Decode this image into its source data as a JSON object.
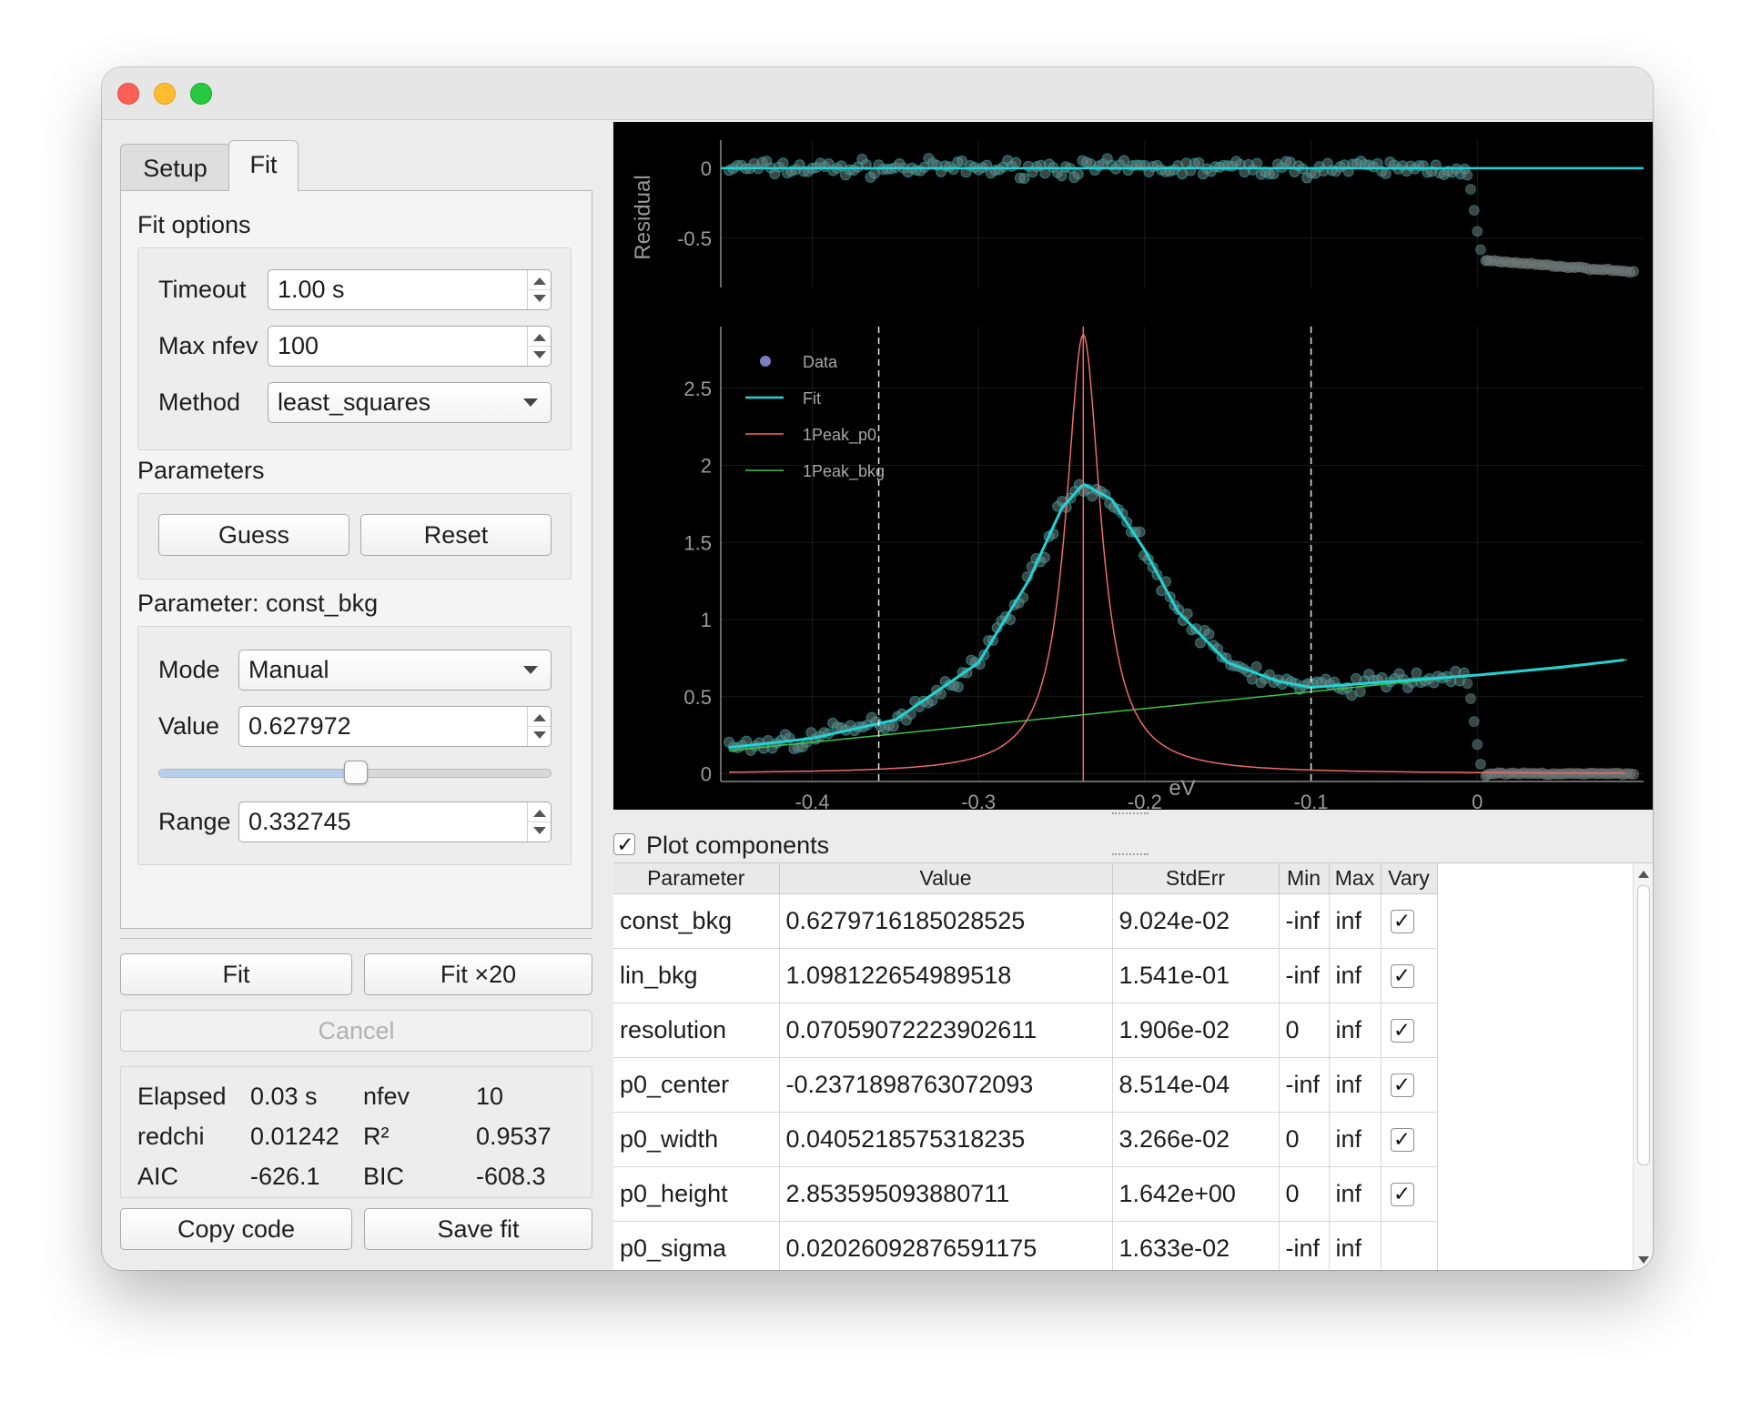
{
  "tabs": [
    {
      "label": "Setup",
      "active": false
    },
    {
      "label": "Fit",
      "active": true
    }
  ],
  "fit_options": {
    "heading": "Fit options",
    "timeout": {
      "label": "Timeout",
      "value": "1.00 s"
    },
    "max_nfev": {
      "label": "Max nfev",
      "value": "100"
    },
    "method": {
      "label": "Method",
      "value": "least_squares"
    }
  },
  "parameters": {
    "heading": "Parameters",
    "guess_label": "Guess",
    "reset_label": "Reset"
  },
  "parameter_editor": {
    "heading": "Parameter: const_bkg",
    "mode": {
      "label": "Mode",
      "value": "Manual"
    },
    "value": {
      "label": "Value",
      "value": "0.627972"
    },
    "slider_fraction": 0.5,
    "range": {
      "label": "Range",
      "value": "0.332745"
    }
  },
  "actions": {
    "fit_label": "Fit",
    "fit20_label": "Fit ×20",
    "cancel_label": "Cancel",
    "copy_code_label": "Copy code",
    "save_fit_label": "Save fit"
  },
  "stats": {
    "elapsed_label": "Elapsed",
    "elapsed_value": "0.03 s",
    "nfev_label": "nfev",
    "nfev_value": "10",
    "redchi_label": "redchi",
    "redchi_value": "0.01242",
    "r2_label": "R²",
    "r2_value": "0.9537",
    "aic_label": "AIC",
    "aic_value": "-626.1",
    "bic_label": "BIC",
    "bic_value": "-608.3"
  },
  "plot_components": {
    "label": "Plot components",
    "checked": true
  },
  "table": {
    "headers": [
      "Parameter",
      "Value",
      "StdErr",
      "Min",
      "Max",
      "Vary"
    ],
    "rows": [
      {
        "name": "const_bkg",
        "value": "0.6279716185028525",
        "stderr": "9.024e-02",
        "min": "-inf",
        "max": "inf",
        "vary": true
      },
      {
        "name": "lin_bkg",
        "value": "1.098122654989518",
        "stderr": "1.541e-01",
        "min": "-inf",
        "max": "inf",
        "vary": true
      },
      {
        "name": "resolution",
        "value": "0.07059072223902611",
        "stderr": "1.906e-02",
        "min": "0",
        "max": "inf",
        "vary": true
      },
      {
        "name": "p0_center",
        "value": "-0.2371898763072093",
        "stderr": "8.514e-04",
        "min": "-inf",
        "max": "inf",
        "vary": true
      },
      {
        "name": "p0_width",
        "value": "0.0405218575318235",
        "stderr": "3.266e-02",
        "min": "0",
        "max": "inf",
        "vary": true
      },
      {
        "name": "p0_height",
        "value": "2.853595093880711",
        "stderr": "1.642e+00",
        "min": "0",
        "max": "inf",
        "vary": true
      },
      {
        "name": "p0_sigma",
        "value": "0.02026092876591175",
        "stderr": "1.633e-02",
        "min": "-inf",
        "max": "inf",
        "vary": false
      }
    ]
  },
  "chart_data": [
    {
      "type": "scatter",
      "panel": "residual",
      "ylabel": "Residual",
      "ylim": [
        -0.85,
        0.2
      ],
      "xlim": [
        -0.455,
        0.1
      ],
      "y_ticks": [
        0,
        -0.5
      ],
      "zero_line": 0,
      "colors": {
        "data": "#6f7f7e",
        "data_edge": "#1fb8b8",
        "fit": "#22d3d3",
        "background": "#000000"
      },
      "series": [
        {
          "kind": "residual_band",
          "x_range": [
            -0.45,
            -0.007
          ],
          "y_center": 0.0,
          "y_spread": 0.14
        },
        {
          "kind": "residual_drop",
          "x": [
            -0.006,
            -0.004,
            -0.002,
            0.0,
            0.002,
            0.005
          ],
          "y": [
            -0.05,
            -0.15,
            -0.3,
            -0.45,
            -0.58,
            -0.66
          ]
        },
        {
          "kind": "residual_tail",
          "x_range": [
            0.006,
            0.095
          ],
          "y_start": -0.66,
          "y_end": -0.74
        }
      ]
    },
    {
      "type": "line",
      "panel": "main",
      "xlabel": "eV",
      "xlim": [
        -0.455,
        0.1
      ],
      "ylim": [
        -0.05,
        2.9
      ],
      "x_ticks": [
        -0.4,
        -0.3,
        -0.2,
        -0.1,
        0
      ],
      "y_ticks": [
        0,
        0.5,
        1,
        1.5,
        2,
        2.5
      ],
      "legend": {
        "placement": "top-left",
        "entries": [
          "Data",
          "Fit",
          "1Peak_p0",
          "1Peak_bkg"
        ]
      },
      "vertical_markers": {
        "dashed": [
          -0.36,
          -0.1
        ],
        "solid": [
          -0.237
        ]
      },
      "colors": {
        "data": "#6f7f7e",
        "data_edge": "#1fb8b8",
        "fit": "#22d3d3",
        "peak": "#ef6b6b",
        "bkg": "#3fc54a",
        "legend_data_marker": "#7b7fbf"
      },
      "series": [
        {
          "name": "1Peak_bkg",
          "x": [
            -0.45,
            0.09
          ],
          "y": [
            0.15,
            0.74
          ]
        },
        {
          "name": "1Peak_p0",
          "center": -0.237,
          "width": 0.0405,
          "height": 2.85
        },
        {
          "name": "Fit",
          "x": [
            -0.45,
            -0.4,
            -0.35,
            -0.3,
            -0.27,
            -0.25,
            -0.237,
            -0.22,
            -0.2,
            -0.18,
            -0.15,
            -0.12,
            -0.1,
            -0.05,
            0,
            0.05,
            0.09
          ],
          "y": [
            0.17,
            0.23,
            0.35,
            0.72,
            1.25,
            1.72,
            1.88,
            1.78,
            1.45,
            1.05,
            0.72,
            0.6,
            0.56,
            0.6,
            0.64,
            0.69,
            0.74
          ]
        },
        {
          "name": "Data",
          "note": "scattered about Fit up to x=-0.006, then a step drop to ~0.0 for x>0"
        }
      ]
    }
  ]
}
